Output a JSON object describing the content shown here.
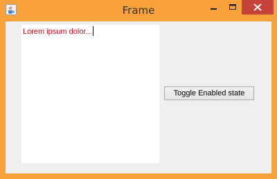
{
  "window": {
    "title": "Frame",
    "frame_color": "#f9a13a",
    "close_button_color": "#c7423a",
    "icons": {
      "app": "java-cup-icon",
      "minimize": "minimize-icon",
      "maximize": "maximize-icon",
      "close": "close-icon"
    }
  },
  "editor": {
    "text": "Lorem ipsum dolor...",
    "text_color": "#c8101e"
  },
  "buttons": {
    "toggle_label": "Toggle Enabled state"
  }
}
